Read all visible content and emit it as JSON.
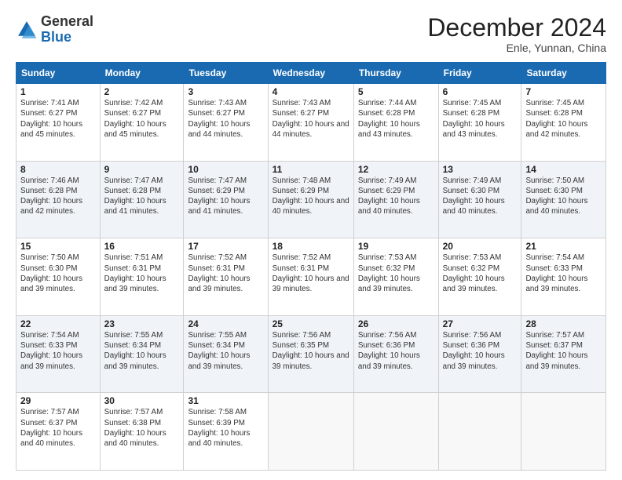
{
  "logo": {
    "text_general": "General",
    "text_blue": "Blue"
  },
  "header": {
    "month": "December 2024",
    "location": "Enle, Yunnan, China"
  },
  "days_of_week": [
    "Sunday",
    "Monday",
    "Tuesday",
    "Wednesday",
    "Thursday",
    "Friday",
    "Saturday"
  ],
  "weeks": [
    [
      {
        "day": "1",
        "sunrise": "Sunrise: 7:41 AM",
        "sunset": "Sunset: 6:27 PM",
        "daylight": "Daylight: 10 hours and 45 minutes."
      },
      {
        "day": "2",
        "sunrise": "Sunrise: 7:42 AM",
        "sunset": "Sunset: 6:27 PM",
        "daylight": "Daylight: 10 hours and 45 minutes."
      },
      {
        "day": "3",
        "sunrise": "Sunrise: 7:43 AM",
        "sunset": "Sunset: 6:27 PM",
        "daylight": "Daylight: 10 hours and 44 minutes."
      },
      {
        "day": "4",
        "sunrise": "Sunrise: 7:43 AM",
        "sunset": "Sunset: 6:27 PM",
        "daylight": "Daylight: 10 hours and 44 minutes."
      },
      {
        "day": "5",
        "sunrise": "Sunrise: 7:44 AM",
        "sunset": "Sunset: 6:28 PM",
        "daylight": "Daylight: 10 hours and 43 minutes."
      },
      {
        "day": "6",
        "sunrise": "Sunrise: 7:45 AM",
        "sunset": "Sunset: 6:28 PM",
        "daylight": "Daylight: 10 hours and 43 minutes."
      },
      {
        "day": "7",
        "sunrise": "Sunrise: 7:45 AM",
        "sunset": "Sunset: 6:28 PM",
        "daylight": "Daylight: 10 hours and 42 minutes."
      }
    ],
    [
      {
        "day": "8",
        "sunrise": "Sunrise: 7:46 AM",
        "sunset": "Sunset: 6:28 PM",
        "daylight": "Daylight: 10 hours and 42 minutes."
      },
      {
        "day": "9",
        "sunrise": "Sunrise: 7:47 AM",
        "sunset": "Sunset: 6:28 PM",
        "daylight": "Daylight: 10 hours and 41 minutes."
      },
      {
        "day": "10",
        "sunrise": "Sunrise: 7:47 AM",
        "sunset": "Sunset: 6:29 PM",
        "daylight": "Daylight: 10 hours and 41 minutes."
      },
      {
        "day": "11",
        "sunrise": "Sunrise: 7:48 AM",
        "sunset": "Sunset: 6:29 PM",
        "daylight": "Daylight: 10 hours and 40 minutes."
      },
      {
        "day": "12",
        "sunrise": "Sunrise: 7:49 AM",
        "sunset": "Sunset: 6:29 PM",
        "daylight": "Daylight: 10 hours and 40 minutes."
      },
      {
        "day": "13",
        "sunrise": "Sunrise: 7:49 AM",
        "sunset": "Sunset: 6:30 PM",
        "daylight": "Daylight: 10 hours and 40 minutes."
      },
      {
        "day": "14",
        "sunrise": "Sunrise: 7:50 AM",
        "sunset": "Sunset: 6:30 PM",
        "daylight": "Daylight: 10 hours and 40 minutes."
      }
    ],
    [
      {
        "day": "15",
        "sunrise": "Sunrise: 7:50 AM",
        "sunset": "Sunset: 6:30 PM",
        "daylight": "Daylight: 10 hours and 39 minutes."
      },
      {
        "day": "16",
        "sunrise": "Sunrise: 7:51 AM",
        "sunset": "Sunset: 6:31 PM",
        "daylight": "Daylight: 10 hours and 39 minutes."
      },
      {
        "day": "17",
        "sunrise": "Sunrise: 7:52 AM",
        "sunset": "Sunset: 6:31 PM",
        "daylight": "Daylight: 10 hours and 39 minutes."
      },
      {
        "day": "18",
        "sunrise": "Sunrise: 7:52 AM",
        "sunset": "Sunset: 6:31 PM",
        "daylight": "Daylight: 10 hours and 39 minutes."
      },
      {
        "day": "19",
        "sunrise": "Sunrise: 7:53 AM",
        "sunset": "Sunset: 6:32 PM",
        "daylight": "Daylight: 10 hours and 39 minutes."
      },
      {
        "day": "20",
        "sunrise": "Sunrise: 7:53 AM",
        "sunset": "Sunset: 6:32 PM",
        "daylight": "Daylight: 10 hours and 39 minutes."
      },
      {
        "day": "21",
        "sunrise": "Sunrise: 7:54 AM",
        "sunset": "Sunset: 6:33 PM",
        "daylight": "Daylight: 10 hours and 39 minutes."
      }
    ],
    [
      {
        "day": "22",
        "sunrise": "Sunrise: 7:54 AM",
        "sunset": "Sunset: 6:33 PM",
        "daylight": "Daylight: 10 hours and 39 minutes."
      },
      {
        "day": "23",
        "sunrise": "Sunrise: 7:55 AM",
        "sunset": "Sunset: 6:34 PM",
        "daylight": "Daylight: 10 hours and 39 minutes."
      },
      {
        "day": "24",
        "sunrise": "Sunrise: 7:55 AM",
        "sunset": "Sunset: 6:34 PM",
        "daylight": "Daylight: 10 hours and 39 minutes."
      },
      {
        "day": "25",
        "sunrise": "Sunrise: 7:56 AM",
        "sunset": "Sunset: 6:35 PM",
        "daylight": "Daylight: 10 hours and 39 minutes."
      },
      {
        "day": "26",
        "sunrise": "Sunrise: 7:56 AM",
        "sunset": "Sunset: 6:36 PM",
        "daylight": "Daylight: 10 hours and 39 minutes."
      },
      {
        "day": "27",
        "sunrise": "Sunrise: 7:56 AM",
        "sunset": "Sunset: 6:36 PM",
        "daylight": "Daylight: 10 hours and 39 minutes."
      },
      {
        "day": "28",
        "sunrise": "Sunrise: 7:57 AM",
        "sunset": "Sunset: 6:37 PM",
        "daylight": "Daylight: 10 hours and 39 minutes."
      }
    ],
    [
      {
        "day": "29",
        "sunrise": "Sunrise: 7:57 AM",
        "sunset": "Sunset: 6:37 PM",
        "daylight": "Daylight: 10 hours and 40 minutes."
      },
      {
        "day": "30",
        "sunrise": "Sunrise: 7:57 AM",
        "sunset": "Sunset: 6:38 PM",
        "daylight": "Daylight: 10 hours and 40 minutes."
      },
      {
        "day": "31",
        "sunrise": "Sunrise: 7:58 AM",
        "sunset": "Sunset: 6:39 PM",
        "daylight": "Daylight: 10 hours and 40 minutes."
      },
      null,
      null,
      null,
      null
    ]
  ]
}
